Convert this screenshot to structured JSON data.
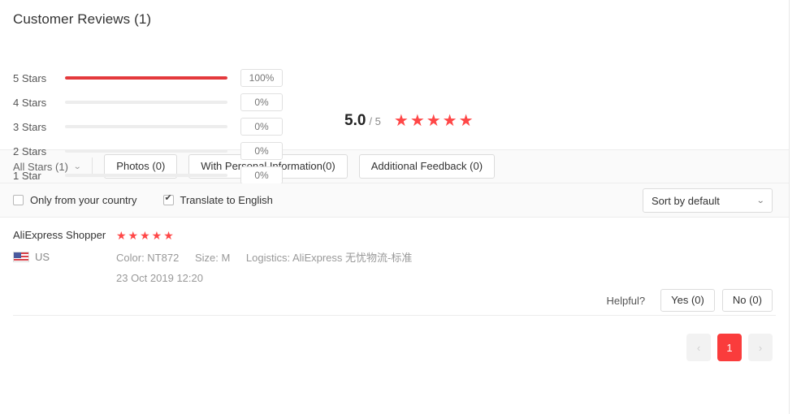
{
  "header": {
    "title": "Customer Reviews (1)"
  },
  "rating_breakdown": {
    "rows": [
      {
        "label": "5 Stars",
        "percent_label": "100%",
        "percent": 100
      },
      {
        "label": "4 Stars",
        "percent_label": "0%",
        "percent": 0
      },
      {
        "label": "3 Stars",
        "percent_label": "0%",
        "percent": 0
      },
      {
        "label": "2 Stars",
        "percent_label": "0%",
        "percent": 0
      },
      {
        "label": "1 Star",
        "percent_label": "0%",
        "percent": 0
      }
    ],
    "fill_color": "#e4393c",
    "track_color": "#ededed"
  },
  "score": {
    "value": "5.0",
    "out_of": "/ 5",
    "stars": "★★★★★",
    "star_color": "#ff4747"
  },
  "filters": {
    "all_stars_label": "All Stars (1)",
    "chevron": "⌄",
    "tabs": [
      {
        "label": "Photos (0)"
      },
      {
        "label": "With Personal Information(0)"
      },
      {
        "label": "Additional Feedback (0)"
      }
    ]
  },
  "options": {
    "only_country_label": "Only from your country",
    "only_country_checked": false,
    "translate_label": "Translate to English",
    "translate_checked": true,
    "sort_value": "Sort by default",
    "sort_chevron": "⌄"
  },
  "review": {
    "user": "AliExpress Shopper",
    "stars": "★★★★★",
    "country": "US",
    "color": "Color: NT872",
    "size": "Size: M",
    "logistics": "Logistics: AliExpress 无忧物流-标准",
    "date": "23 Oct 2019 12:20",
    "helpful_label": "Helpful?",
    "yes_label": "Yes (0)",
    "no_label": "No (0)"
  },
  "pagination": {
    "prev": "‹",
    "current": "1",
    "next": "›",
    "active_color": "#fa3c3c"
  }
}
